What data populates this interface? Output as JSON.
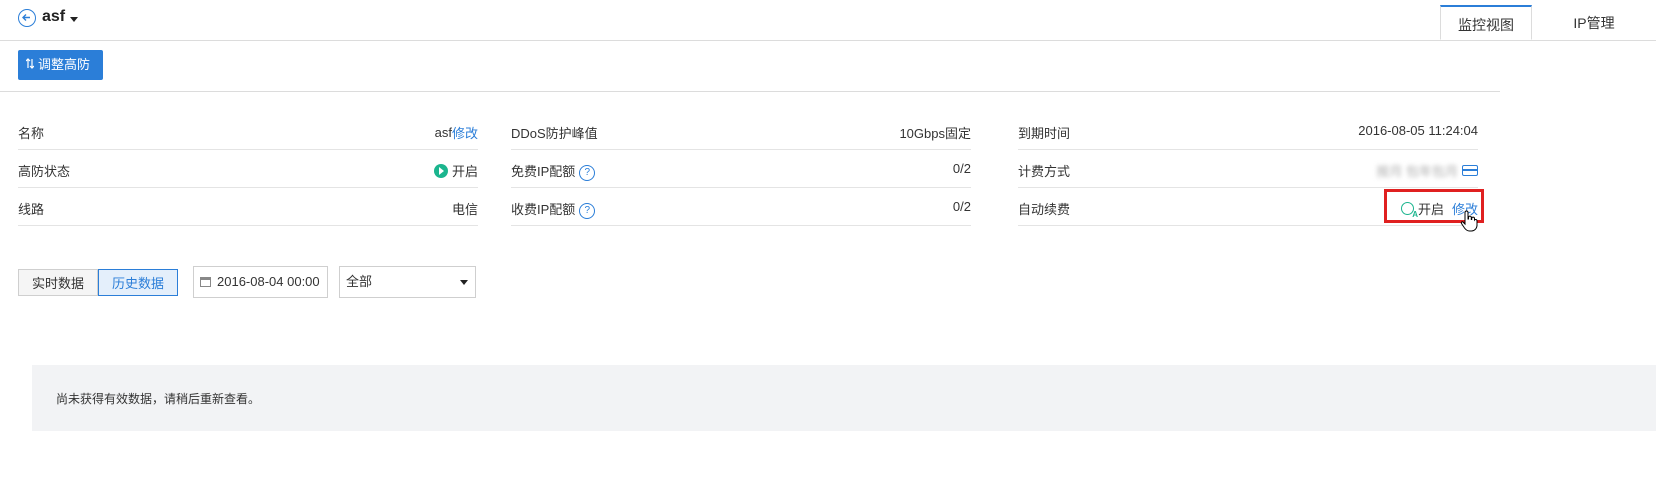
{
  "header": {
    "title": "asf",
    "tabs": [
      {
        "label": "监控视图",
        "active": true
      },
      {
        "label": "IP管理",
        "active": false
      }
    ]
  },
  "toolbar": {
    "adjust_label": "调整高防",
    "adjust_icon": "sort-icon"
  },
  "info": {
    "col1": [
      {
        "label": "名称",
        "value": "asf",
        "link": "修改"
      },
      {
        "label": "高防状态",
        "value": "开启"
      },
      {
        "label": "线路",
        "value": "电信"
      }
    ],
    "col2": [
      {
        "label": "DDoS防护峰值",
        "value": "10Gbps固定"
      },
      {
        "label": "免费IP配额",
        "value": "0/2",
        "help": "?"
      },
      {
        "label": "收费IP配额",
        "value": "0/2",
        "help": "?"
      }
    ],
    "col3": [
      {
        "label": "到期时间",
        "value": "2016-08-05 11:24:04"
      },
      {
        "label": "计费方式",
        "value": "按月 包年包月"
      },
      {
        "label": "自动续费",
        "value": "开启",
        "link": "修改"
      }
    ]
  },
  "data_controls": {
    "tabs": [
      {
        "label": "实时数据",
        "active": false
      },
      {
        "label": "历史数据",
        "active": true
      }
    ],
    "date_value": "2016-08-04 00:00",
    "select_value": "全部"
  },
  "empty_message": "尚未获得有效数据，请稍后重新查看。",
  "colors": {
    "accent": "#2b7ed8",
    "status_green": "#1bb58e",
    "highlight_red": "#e02020"
  }
}
